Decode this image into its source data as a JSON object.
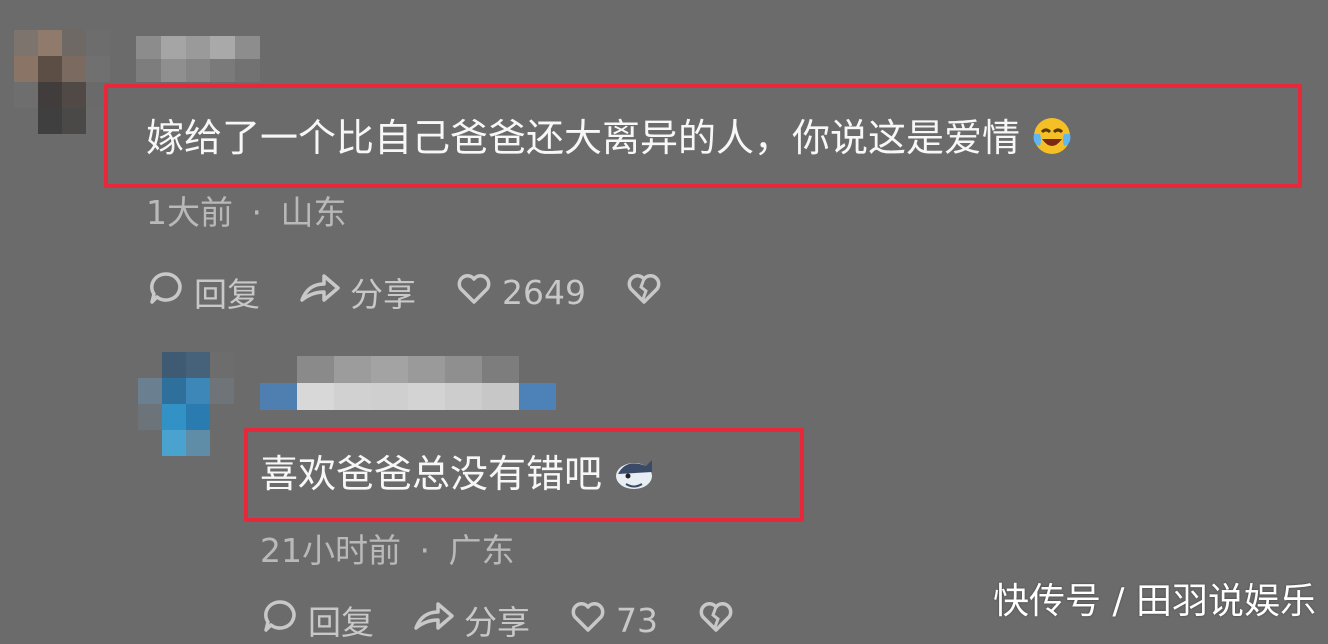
{
  "comments": [
    {
      "text": "嫁给了一个比自己爸爸还大离异的人，你说这是爱情",
      "emoji": "laughing-crying-emoji",
      "time": "1大前",
      "separator": "·",
      "location": "山东",
      "actions": {
        "reply": "回复",
        "share": "分享",
        "likes": "2649"
      }
    },
    {
      "text": "喜欢爸爸总没有错吧",
      "emoji": "whale-emoji",
      "time": "21小时前",
      "separator": "·",
      "location": "广东",
      "actions": {
        "reply": "回复",
        "share": "分享",
        "likes": "73"
      }
    }
  ],
  "watermark": "快传号 / 田羽说娱乐",
  "colors": {
    "background": "#6b6b6b",
    "highlight_border": "#e6283a"
  }
}
